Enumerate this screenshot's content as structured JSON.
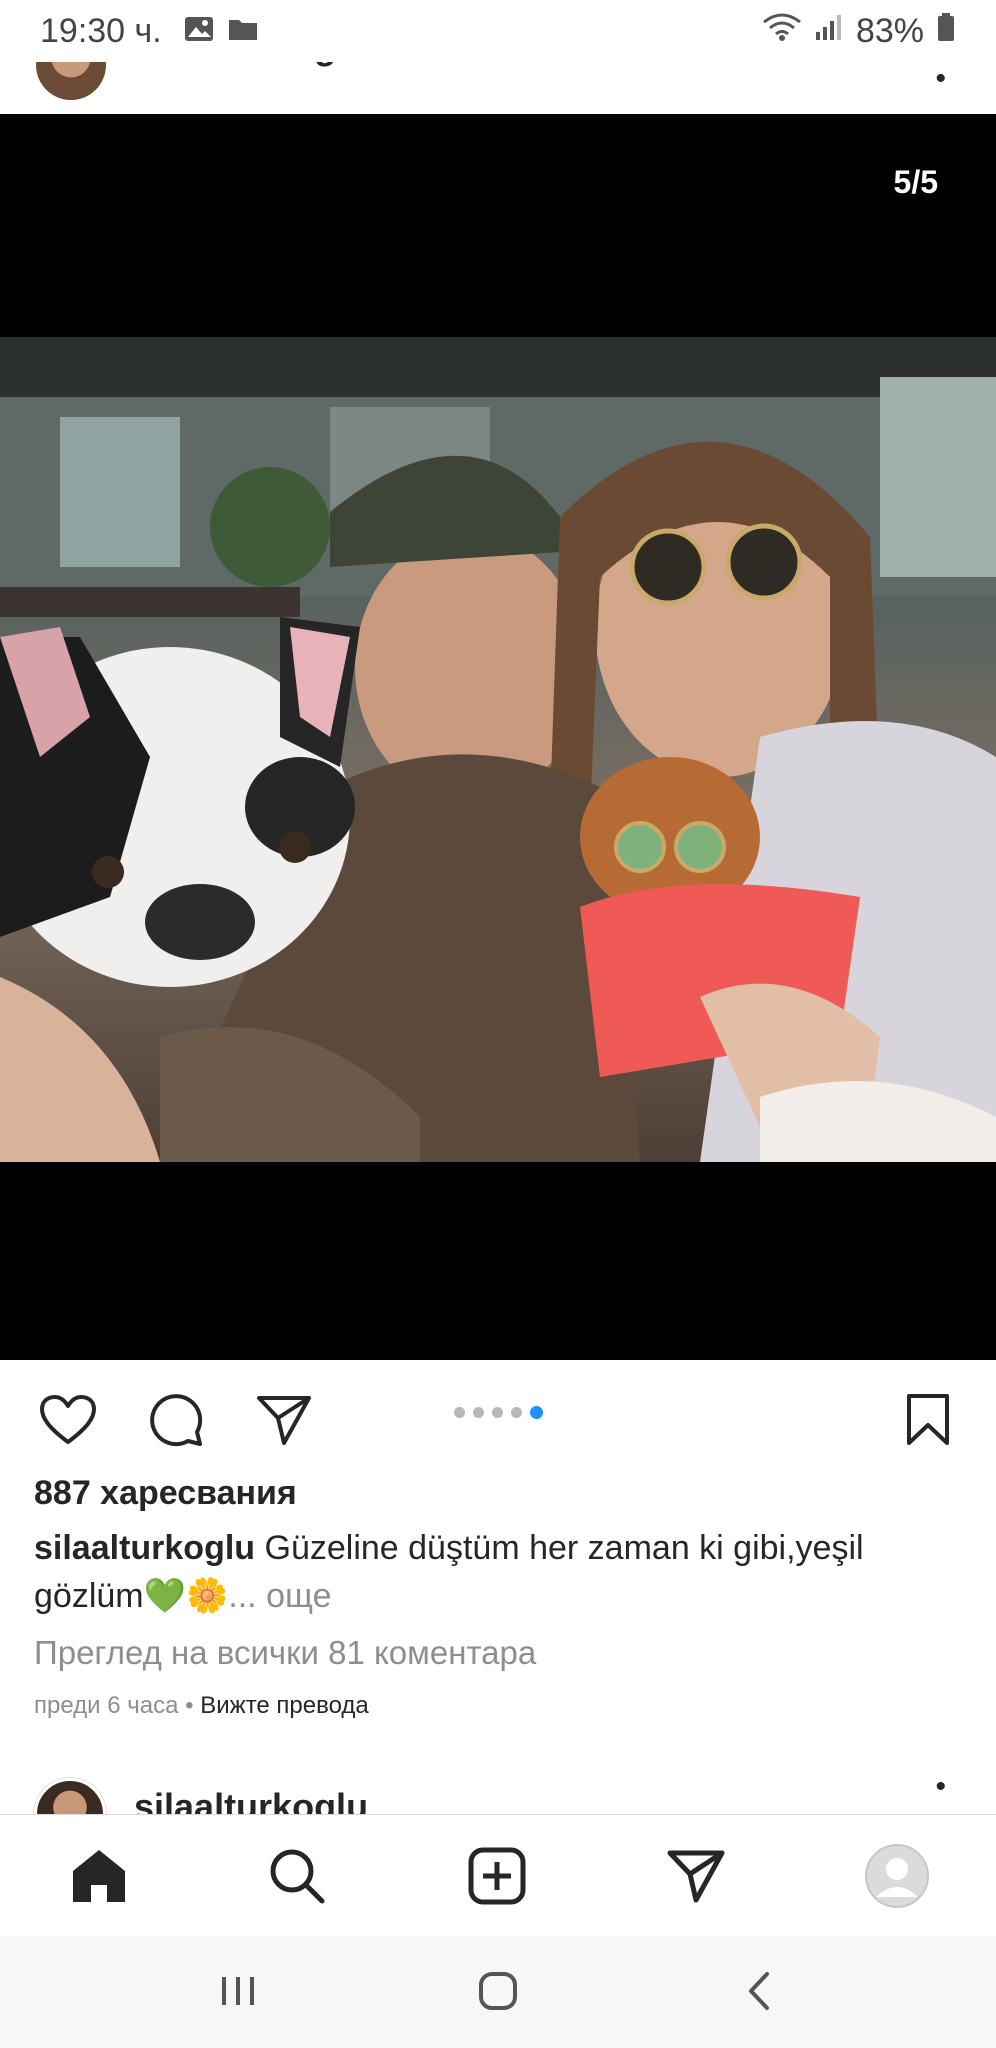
{
  "status_bar": {
    "time": "19:30 ч.",
    "battery": "83%",
    "icons": [
      "gallery-icon",
      "folder-icon",
      "wifi-icon",
      "signal-icon",
      "battery-icon"
    ]
  },
  "post": {
    "username": "silaalturkoglu",
    "counter": "5/5",
    "carousel": {
      "count": 5,
      "active": 5
    },
    "likes": "887 харесвания",
    "caption_user": "silaalturkoglu",
    "caption_text": " Güzeline düştüm her zaman ki gibi,yeşil gözlüm💚🌼",
    "caption_more": "... още",
    "comments_link": "Преглед на всички 81 коментара",
    "time_ago": "преди 6 часа",
    "separator": " • ",
    "translate": "Вижте превода"
  },
  "next_post": {
    "username": "silaalturkoglu"
  },
  "colors": {
    "accent": "#1e90ff",
    "text": "#262626",
    "muted": "#8e8e8e"
  }
}
